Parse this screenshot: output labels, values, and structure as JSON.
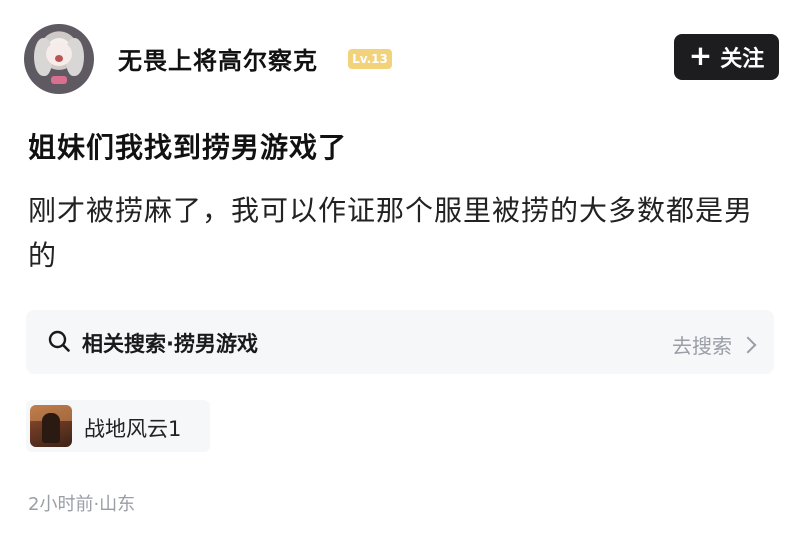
{
  "post": {
    "author": {
      "name": "无畏上将高尔察克",
      "level": "Lv.13",
      "avatar_icon": "anime-girl-avatar"
    },
    "follow_button": {
      "icon": "plus-icon",
      "label": "关注"
    },
    "title": "姐妹们我找到捞男游戏了",
    "body": "刚才被捞麻了，我可以作证那个服里被捞的大多数都是男的",
    "related_search": {
      "icon": "search-icon",
      "label": "相关搜索·捞男游戏",
      "action": "去搜索"
    },
    "game_tag": {
      "name": "战地风云1",
      "thumbnail_icon": "game-thumbnail"
    },
    "meta": "2小时前·山东"
  },
  "colors": {
    "follow_bg": "#1d1d1f",
    "level_badge": "#f2d27a",
    "card_bg": "#f6f7f9",
    "muted_text": "#9a9ea6"
  }
}
